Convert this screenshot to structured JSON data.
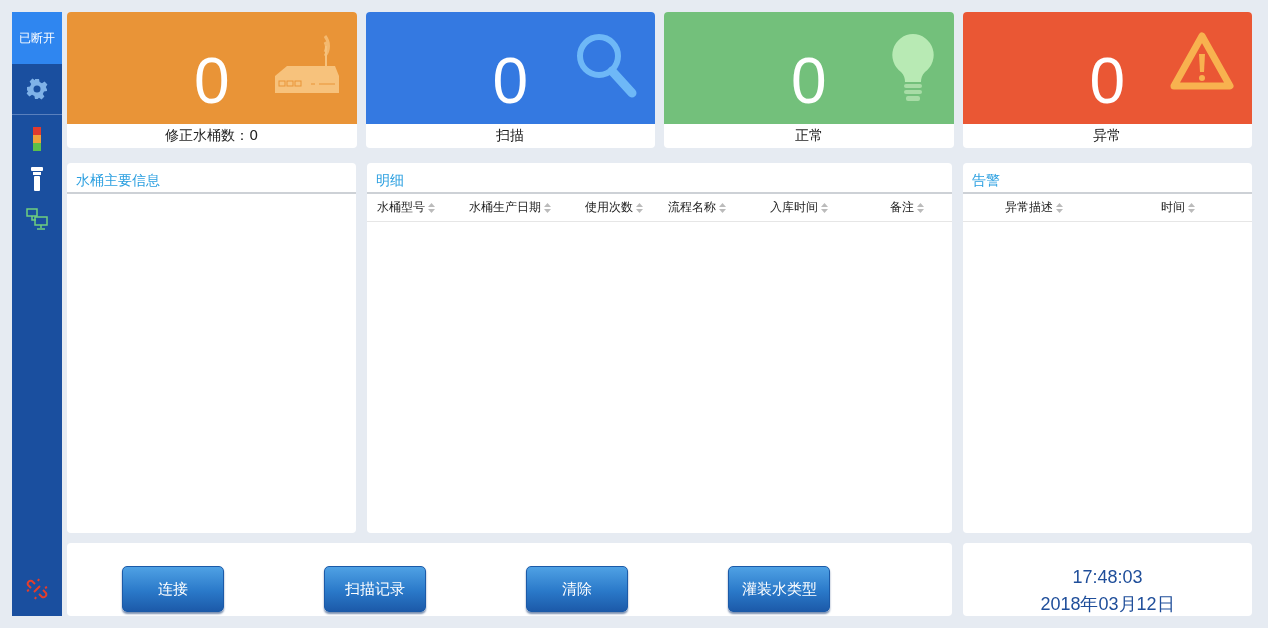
{
  "sidebar": {
    "status": {
      "label": "已断开",
      "selected": true
    },
    "items": [
      {
        "kind": "settings",
        "selected": false
      },
      {
        "kind": "signal-light",
        "selected": false
      },
      {
        "kind": "tower-lamp",
        "selected": false
      },
      {
        "kind": "network",
        "selected": false
      }
    ],
    "footer_icon": {
      "kind": "unlink"
    }
  },
  "stats": [
    {
      "value": "0",
      "label": "修正水桶数：0",
      "color": "#e99437",
      "kind": "router"
    },
    {
      "value": "0",
      "label": "扫描",
      "color": "#3479e1",
      "kind": "search"
    },
    {
      "value": "0",
      "label": "正常",
      "color": "#73c07b",
      "kind": "bulb"
    },
    {
      "value": "0",
      "label": "异常",
      "color": "#ea5734",
      "kind": "warning"
    }
  ],
  "info_panel": {
    "title": "水桶主要信息"
  },
  "detail_panel": {
    "title": "明细",
    "columns": [
      "水桶型号",
      "水桶生产日期",
      "使用次数",
      "流程名称",
      "入库时间",
      "备注"
    ]
  },
  "alarm_panel": {
    "title": "告警",
    "columns": [
      "异常描述",
      "时间"
    ]
  },
  "buttons": [
    "连接",
    "扫描记录",
    "清除",
    "灌装水类型"
  ],
  "clock": {
    "time": "17:48:03",
    "date": "2018年03月12日"
  }
}
